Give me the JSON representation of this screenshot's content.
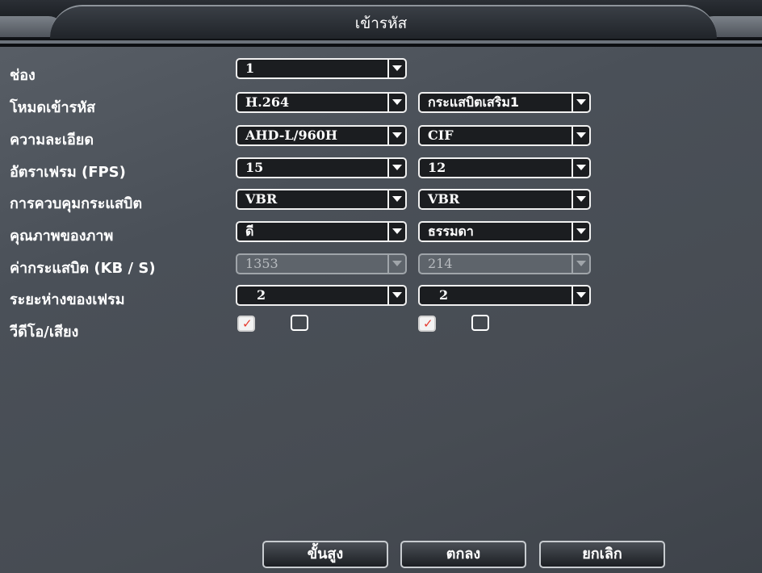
{
  "window": {
    "title": "เข้ารหัส"
  },
  "rows": [
    {
      "label": "ช่อง",
      "main": "1"
    },
    {
      "label": "โหมดเข้ารหัส",
      "main": "H.264",
      "extra": "กระแสบิตเสริม1"
    },
    {
      "label": "ความละเอียด",
      "main": "AHD-L/960H",
      "extra": "CIF"
    },
    {
      "label": "อัตราเฟรม (FPS)",
      "main": "15",
      "extra": "12"
    },
    {
      "label": "การควบคุมกระแสบิต",
      "main": "VBR",
      "extra": "VBR"
    },
    {
      "label": "คุณภาพของภาพ",
      "main": "ดี",
      "extra": "ธรรมดา"
    },
    {
      "label": "ค่ากระแสบิต (KB / S)",
      "main": "1353",
      "extra": "214"
    },
    {
      "label": "ระยะห่างของเฟรม",
      "main": "2",
      "extra": "2"
    },
    {
      "label": "วีดีโอ/เสียง"
    }
  ],
  "checkboxes": {
    "main_video": true,
    "main_audio": false,
    "extra_video": true,
    "extra_audio": false
  },
  "buttons": {
    "advanced": "ขั้นสูง",
    "ok": "ตกลง",
    "cancel": "ยกเลิก"
  },
  "colors": {
    "checkmark": "#e63a2e",
    "panel": "#4a5058"
  }
}
